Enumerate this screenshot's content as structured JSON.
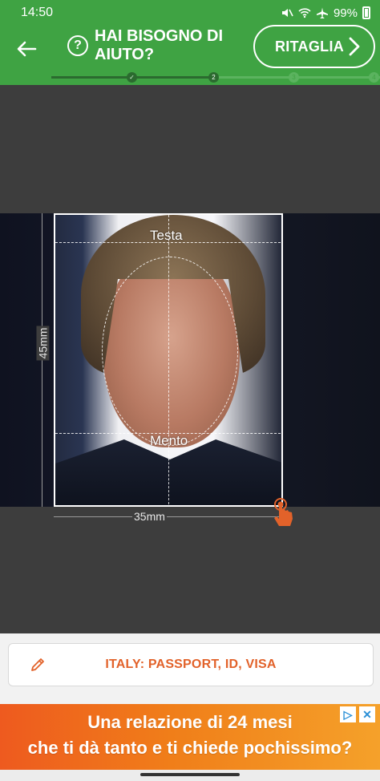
{
  "status_bar": {
    "time": "14:50",
    "battery": "99%"
  },
  "header": {
    "help_text": "HAI BISOGNO DI AIUTO?",
    "crop_label": "RITAGLIA",
    "steps": [
      "✓",
      "2",
      "3",
      "4"
    ],
    "current_step": 2
  },
  "editor": {
    "top_label": "Testa",
    "bottom_label": "Mento",
    "width_label": "35mm",
    "height_label": "45mm"
  },
  "preset": {
    "label": "ITALY: PASSPORT, ID, VISA"
  },
  "ad": {
    "line1": "Una relazione di 24 mesi",
    "line2": "che ti dà tanto e ti chiede pochissimo?"
  },
  "colors": {
    "primary": "#3fa343",
    "accent": "#e2622a"
  }
}
